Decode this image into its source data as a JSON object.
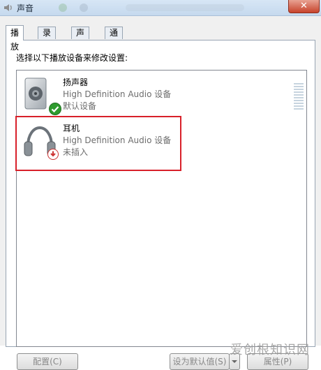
{
  "window": {
    "title": "声音",
    "close_symbol": "✕"
  },
  "tabs": [
    {
      "label": "播放",
      "active": true
    },
    {
      "label": "录制",
      "active": false
    },
    {
      "label": "声音",
      "active": false
    },
    {
      "label": "通信",
      "active": false
    }
  ],
  "instruction": "选择以下播放设备来修改设置:",
  "devices": [
    {
      "name": "扬声器",
      "description": "High Definition Audio 设备",
      "status": "默认设备",
      "icon": "speaker-icon",
      "badge": "default-check-icon"
    },
    {
      "name": "耳机",
      "description": "High Definition Audio 设备",
      "status": "未插入",
      "icon": "headphones-icon",
      "badge": "unplugged-icon"
    }
  ],
  "buttons": {
    "configure": "配置(C)",
    "set_default": "设为默认值(S)",
    "properties": "属性(P)"
  },
  "watermark": "爱创根知识网",
  "colors": {
    "highlight": "#d8202a",
    "default_check": "#2e9b2e"
  }
}
